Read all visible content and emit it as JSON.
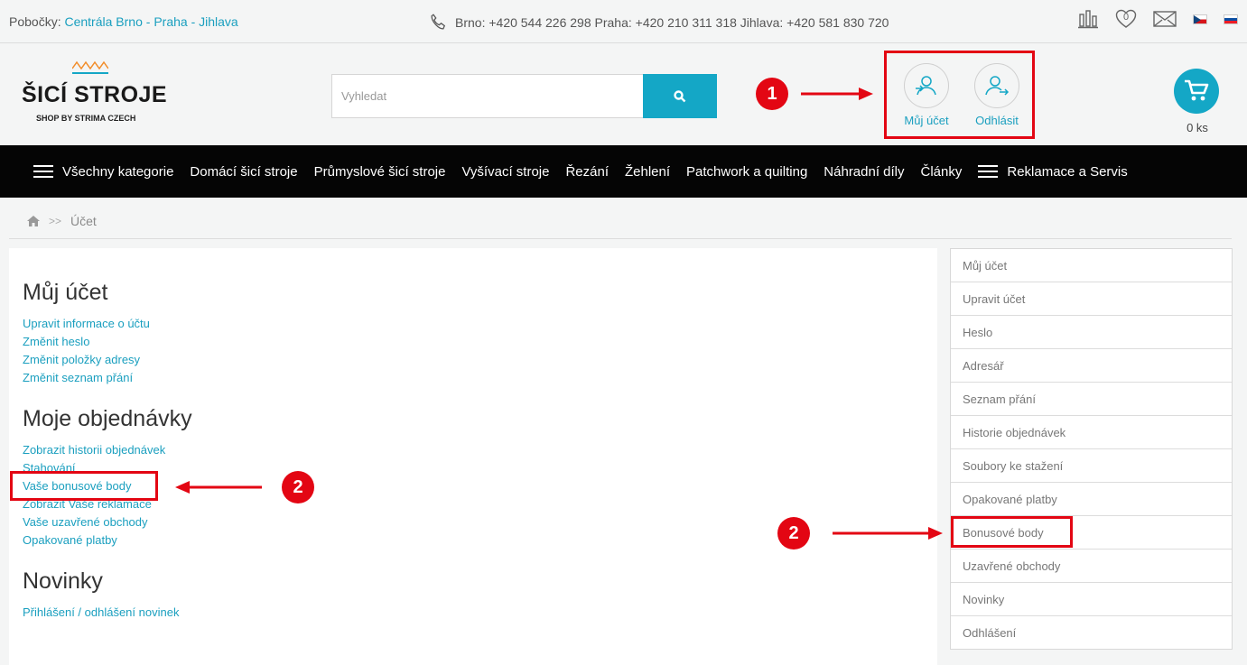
{
  "topbar": {
    "branches_label": "Pobočky:",
    "branches": [
      "Centrála Brno",
      "Praha",
      "Jihlava"
    ],
    "branch_sep": "-",
    "phones": "Brno: +420 544 226 298 Praha: +420 210 311 318 Jihlava: +420 581 830 720",
    "wishlist_count": "0"
  },
  "header": {
    "logo_title": "ŠICÍ STROJE",
    "logo_sub": "SHOP BY STRIMA CZECH",
    "search_placeholder": "Vyhledat",
    "account_label": "Můj účet",
    "logout_label": "Odhlásit",
    "cart_count": "0 ks"
  },
  "annotations": {
    "badge1": "1",
    "badge2": "2"
  },
  "nav": {
    "items": [
      "Všechny kategorie",
      "Domácí šicí stroje",
      "Průmyslové šicí stroje",
      "Vyšívací stroje",
      "Řezání",
      "Žehlení",
      "Patchwork a quilting",
      "Náhradní díly",
      "Články",
      "Reklamace a Servis"
    ]
  },
  "breadcrumb": {
    "sep": ">>",
    "current": "Účet"
  },
  "main": {
    "sections": [
      {
        "title": "Můj účet",
        "links": [
          "Upravit informace o účtu",
          "Změnit heslo",
          "Změnit položky adresy",
          "Změnit seznam přání"
        ]
      },
      {
        "title": "Moje objednávky",
        "links": [
          "Zobrazit historii objednávek",
          "Stahování",
          "Vaše bonusové body",
          "Zobrazit Vaše reklamace",
          "Vaše uzavřené obchody",
          "Opakované platby"
        ]
      },
      {
        "title": "Novinky",
        "links": [
          "Přihlášení / odhlášení novinek"
        ]
      }
    ]
  },
  "sidebar": {
    "items": [
      "Můj účet",
      "Upravit účet",
      "Heslo",
      "Adresář",
      "Seznam přání",
      "Historie objednávek",
      "Soubory ke stažení",
      "Opakované platby",
      "Bonusové body",
      "Uzavřené obchody",
      "Novinky",
      "Odhlášení"
    ]
  },
  "colors": {
    "accent": "#14a7c6",
    "link": "#1a9fbf",
    "annotation": "#e30613",
    "nav_bg": "#050505"
  }
}
